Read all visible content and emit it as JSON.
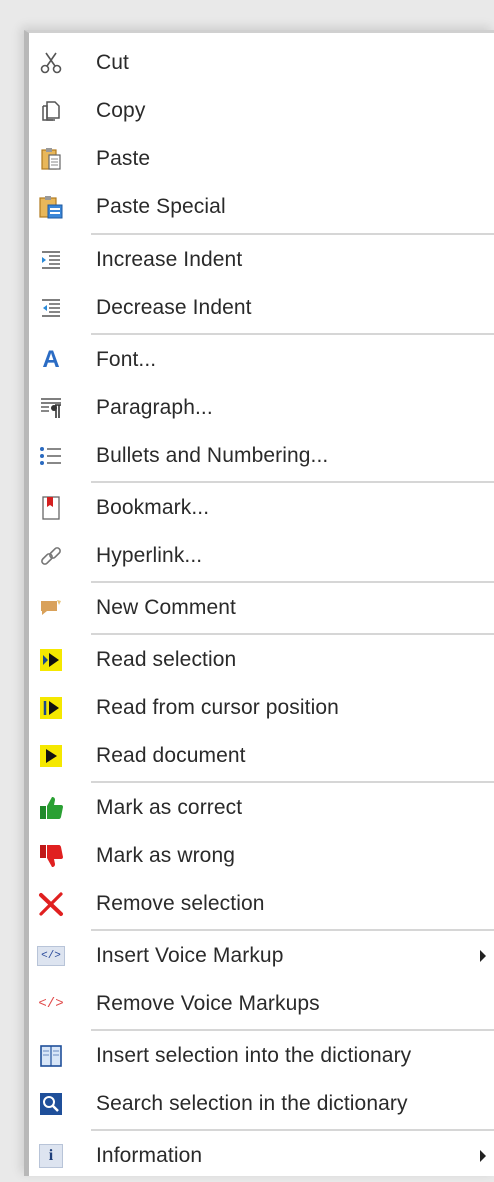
{
  "menu": {
    "items": [
      {
        "label": "Cut",
        "icon": "scissors-icon"
      },
      {
        "label": "Copy",
        "icon": "copy-icon"
      },
      {
        "label": "Paste",
        "icon": "paste-icon"
      },
      {
        "label": "Paste Special",
        "icon": "paste-special-icon"
      },
      {
        "label": "Increase Indent",
        "icon": "increase-indent-icon"
      },
      {
        "label": "Decrease Indent",
        "icon": "decrease-indent-icon"
      },
      {
        "label": "Font...",
        "icon": "font-icon"
      },
      {
        "label": "Paragraph...",
        "icon": "paragraph-icon"
      },
      {
        "label": "Bullets and Numbering...",
        "icon": "bullets-icon"
      },
      {
        "label": "Bookmark...",
        "icon": "bookmark-icon"
      },
      {
        "label": "Hyperlink...",
        "icon": "hyperlink-icon"
      },
      {
        "label": "New Comment",
        "icon": "comment-icon"
      },
      {
        "label": "Read selection",
        "icon": "read-selection-icon"
      },
      {
        "label": "Read from cursor position",
        "icon": "read-cursor-icon"
      },
      {
        "label": "Read document",
        "icon": "read-document-icon"
      },
      {
        "label": "Mark as correct",
        "icon": "thumbs-up-icon"
      },
      {
        "label": "Mark as wrong",
        "icon": "thumbs-down-icon"
      },
      {
        "label": "Remove selection",
        "icon": "red-x-icon"
      },
      {
        "label": "Insert Voice Markup",
        "icon": "voice-markup-icon",
        "submenu": true
      },
      {
        "label": "Remove Voice Markups",
        "icon": "remove-markup-icon"
      },
      {
        "label": "Insert selection into the dictionary",
        "icon": "dictionary-icon"
      },
      {
        "label": "Search selection in the dictionary",
        "icon": "search-dictionary-icon"
      },
      {
        "label": "Information",
        "icon": "info-icon",
        "submenu": true
      }
    ],
    "markup_glyph": "</>",
    "info_glyph": "i",
    "font_glyph": "A"
  },
  "colors": {
    "font_blue": "#2b6cc4",
    "read_yellow": "#f5e800",
    "thumb_green": "#2aa033",
    "thumb_red": "#e02020",
    "markup_red": "#e04a4a",
    "dictionary_blue": "#1f4f9a"
  }
}
